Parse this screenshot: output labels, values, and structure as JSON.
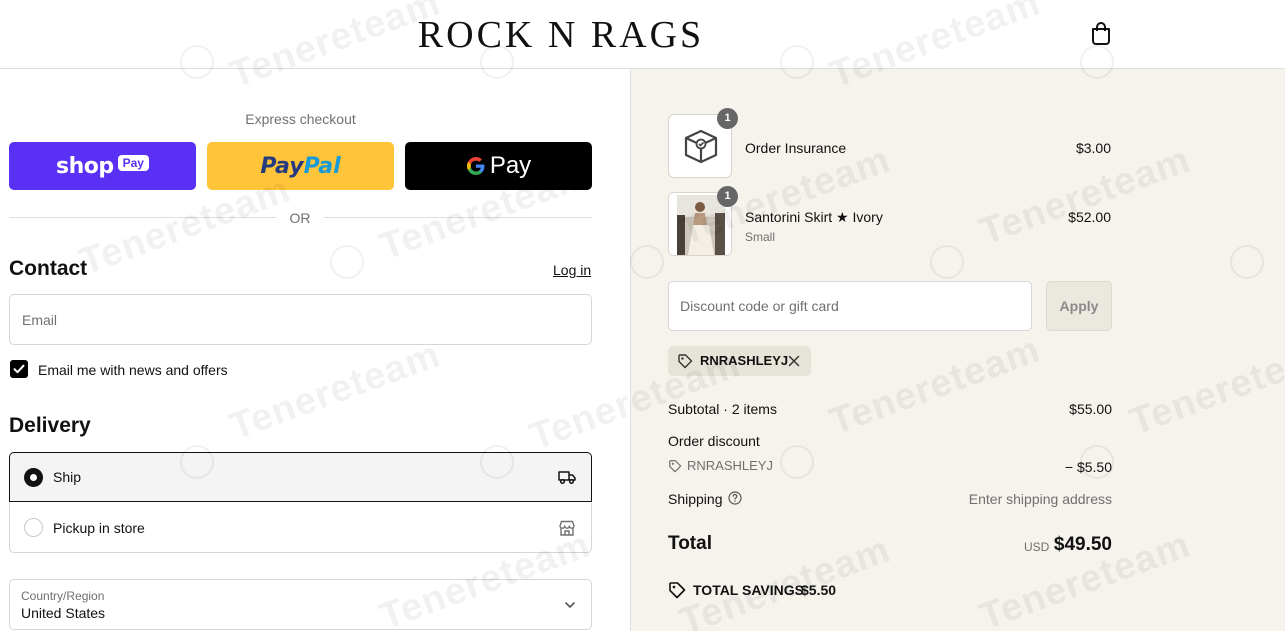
{
  "header": {
    "brand": "ROCK N RAGS",
    "cart_icon": "shopping-bag-icon"
  },
  "express": {
    "title": "Express checkout",
    "shop_label": "shop",
    "shop_badge": "Pay",
    "paypal_part1": "Pay",
    "paypal_part2": "Pal",
    "gpay_label": "Pay",
    "or_label": "OR"
  },
  "contact": {
    "title": "Contact",
    "login_label": "Log in",
    "email_placeholder": "Email",
    "newsletter_label": "Email me with news and offers",
    "newsletter_checked": true
  },
  "delivery": {
    "title": "Delivery",
    "options": [
      {
        "label": "Ship",
        "selected": true,
        "icon": "delivery-truck-icon"
      },
      {
        "label": "Pickup in store",
        "selected": false,
        "icon": "store-icon"
      }
    ],
    "country_label": "Country/Region",
    "country_value": "United States"
  },
  "summary": {
    "items": [
      {
        "name": "Order Insurance",
        "variant": "",
        "price": "$3.00",
        "qty": "1",
        "thumb_icon": "insurance-box-icon"
      },
      {
        "name": "Santorini Skirt ★ Ivory",
        "variant": "Small",
        "price": "$52.00",
        "qty": "1",
        "thumb_icon": "product-photo"
      }
    ],
    "discount_placeholder": "Discount code or gift card",
    "apply_label": "Apply",
    "applied_code": "RNRASHLEYJ",
    "subtotal_label": "Subtotal · 2 items",
    "subtotal_value": "$55.00",
    "order_discount_label": "Order discount",
    "order_discount_code": "RNRASHLEYJ",
    "order_discount_value": "− $5.50",
    "shipping_label": "Shipping",
    "shipping_value": "Enter shipping address",
    "total_label": "Total",
    "currency": "USD",
    "total_value": "$49.50",
    "savings_label": "TOTAL SAVINGS",
    "savings_value": "$5.50"
  },
  "watermark": "Tenereteam",
  "colors": {
    "shop_pay": "#5a31f4",
    "paypal": "#ffc439",
    "gpay": "#000000",
    "summary_bg": "#f5f3ec"
  }
}
